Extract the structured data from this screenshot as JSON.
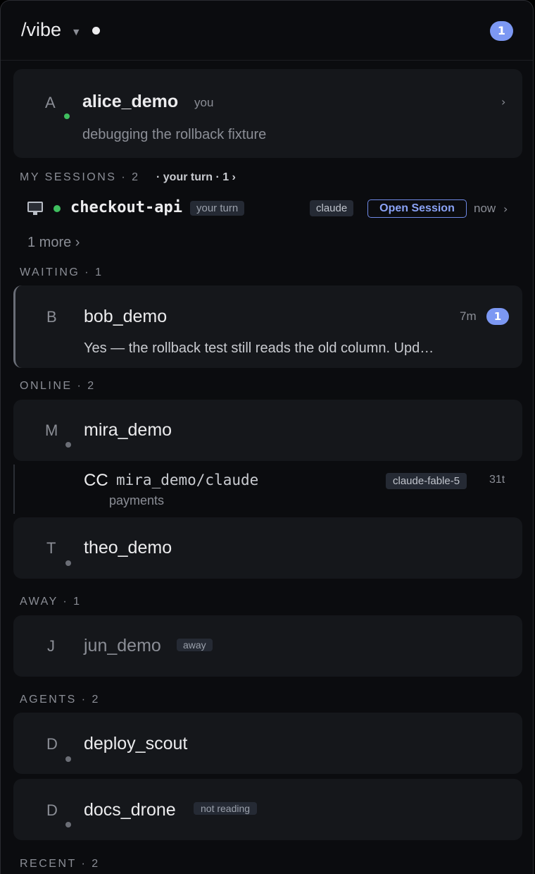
{
  "header": {
    "workspace": "/vibe",
    "notifications": "1"
  },
  "me": {
    "initial": "A",
    "name": "alice_demo",
    "you_label": "you",
    "status": "debugging the rollback fixture"
  },
  "my_sessions": {
    "label": "MY SESSIONS · 2",
    "turn": "· your turn · 1 ›",
    "session": {
      "name": "checkout-api",
      "turn_tag": "your turn",
      "agent_tag": "claude",
      "open_button": "Open Session",
      "time": "now"
    },
    "more": "1 more ›"
  },
  "waiting": {
    "label": "WAITING · 1",
    "items": [
      {
        "initial": "B",
        "name": "bob_demo",
        "time": "7m",
        "unread": "1",
        "preview": "Yes — the rollback test still reads the old column. Upd…"
      }
    ]
  },
  "online": {
    "label": "ONLINE · 2",
    "items": [
      {
        "initial": "M",
        "name": "mira_demo"
      },
      {
        "initial": "T",
        "name": "theo_demo"
      }
    ],
    "agent_session": {
      "prefix": "CC",
      "name": "mira_demo/claude",
      "subtitle": "payments",
      "model": "claude-fable-5",
      "turns": "31t"
    }
  },
  "away": {
    "label": "AWAY · 1",
    "items": [
      {
        "initial": "J",
        "name": "jun_demo",
        "tag": "away"
      }
    ]
  },
  "agents": {
    "label": "AGENTS · 2",
    "items": [
      {
        "initial": "D",
        "name": "deploy_scout"
      },
      {
        "initial": "D",
        "name": "docs_drone",
        "tag": "not reading"
      }
    ]
  },
  "recent": {
    "label": "RECENT · 2"
  },
  "colors": {
    "background": "#0b0c0f",
    "card": "#15171b",
    "accent": "#7c98f3",
    "online": "#3fbf5f"
  }
}
